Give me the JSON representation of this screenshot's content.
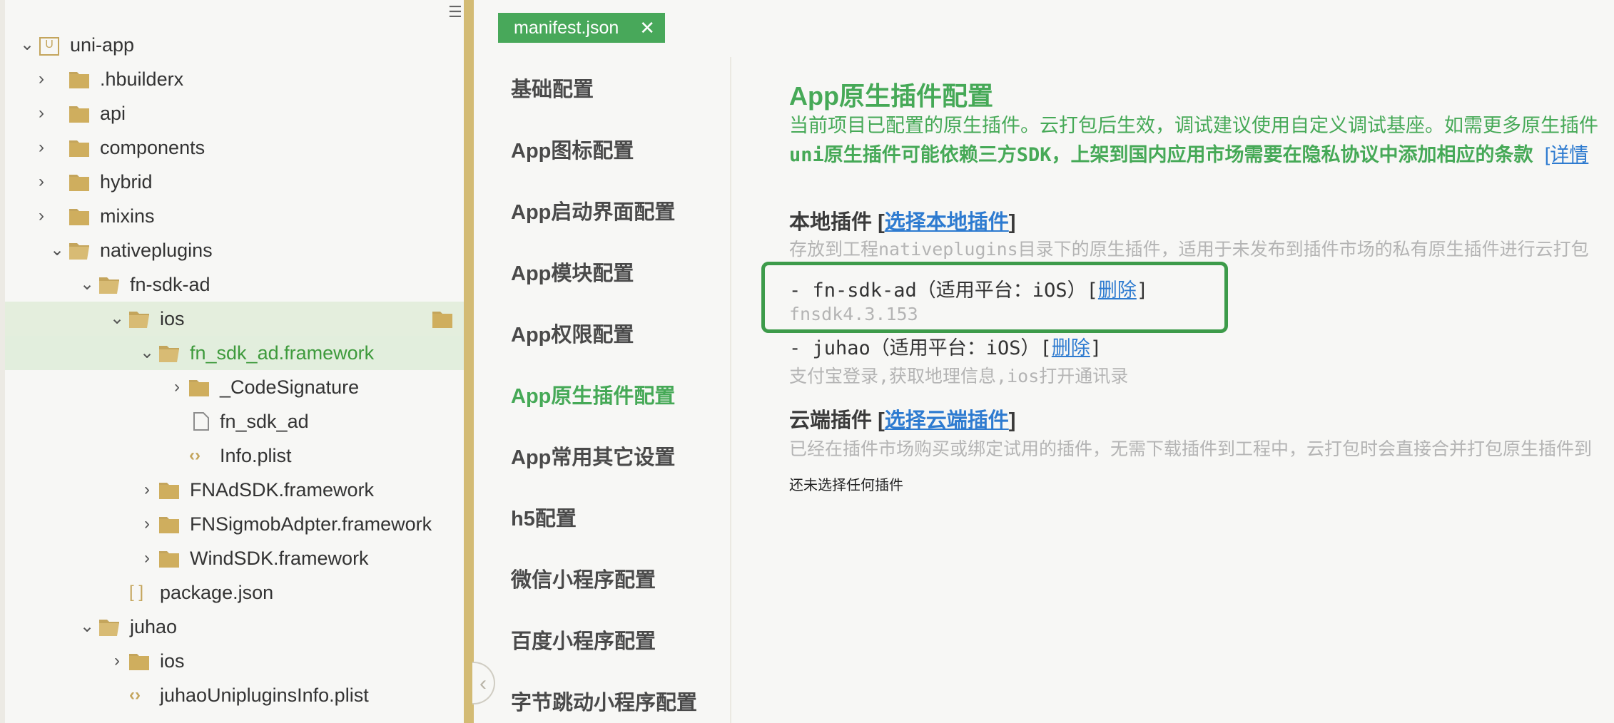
{
  "tree": {
    "rows": [
      {
        "label": "uni-app",
        "type": "app",
        "expanded": true
      },
      {
        "label": ".hbuilderx",
        "type": "folder",
        "expanded": false
      },
      {
        "label": "api",
        "type": "folder",
        "expanded": false
      },
      {
        "label": "components",
        "type": "folder",
        "expanded": false
      },
      {
        "label": "hybrid",
        "type": "folder",
        "expanded": false
      },
      {
        "label": "mixins",
        "type": "folder",
        "expanded": false
      },
      {
        "label": "nativeplugins",
        "type": "folder-open",
        "expanded": true
      },
      {
        "label": "fn-sdk-ad",
        "type": "folder-open",
        "expanded": true
      },
      {
        "label": "ios",
        "type": "folder-open",
        "expanded": true
      },
      {
        "label": "fn_sdk_ad.framework",
        "type": "folder-open",
        "expanded": true
      },
      {
        "label": "_CodeSignature",
        "type": "folder",
        "expanded": false
      },
      {
        "label": "fn_sdk_ad",
        "type": "file"
      },
      {
        "label": "Info.plist",
        "type": "code"
      },
      {
        "label": "FNAdSDK.framework",
        "type": "folder",
        "expanded": false
      },
      {
        "label": "FNSigmobAdpter.framework",
        "type": "folder",
        "expanded": false
      },
      {
        "label": "WindSDK.framework",
        "type": "folder",
        "expanded": false
      },
      {
        "label": "package.json",
        "type": "json"
      },
      {
        "label": "juhao",
        "type": "folder-open",
        "expanded": true
      },
      {
        "label": "ios",
        "type": "folder",
        "expanded": false
      },
      {
        "label": "juhaoUnipluginsInfo.plist",
        "type": "code"
      }
    ]
  },
  "tab": {
    "label": "manifest.json",
    "close": "✕"
  },
  "nav": {
    "items": [
      "基础配置",
      "App图标配置",
      "App启动界面配置",
      "App模块配置",
      "App权限配置",
      "App原生插件配置",
      "App常用其它设置",
      "h5配置",
      "微信小程序配置",
      "百度小程序配置",
      "字节跳动小程序配置"
    ],
    "active_index": 5
  },
  "content": {
    "title": "App原生插件配置",
    "desc1": "当前项目已配置的原生插件。云打包后生效，调试建议使用自定义调试基座。如需更多原生插件",
    "desc2": "uni原生插件可能依赖三方SDK，上架到国内应用市场需要在隐私协议中添加相应的条款",
    "desc2_link": "[详情",
    "local": {
      "head": "本地插件",
      "bracket_open": "[",
      "link": "选择本地插件",
      "bracket_close": "]",
      "hint": "存放到工程nativeplugins目录下的原生插件，适用于未发布到插件市场的私有原生插件进行云打包"
    },
    "plugins": [
      {
        "text": "- fn-sdk-ad（适用平台：iOS）[",
        "link": "删除",
        "close": "]",
        "sub": "fnsdk4.3.153"
      },
      {
        "text": "- juhao（适用平台：iOS）[",
        "link": "删除",
        "close": "]",
        "sub": "支付宝登录,获取地理信息,ios打开通讯录"
      }
    ],
    "cloud": {
      "head": "云端插件",
      "bracket_open": "[",
      "link": "选择云端插件",
      "bracket_close": "]",
      "hint": "已经在插件市场购买或绑定试用的插件，无需下载插件到工程中，云打包时会直接合并打包原生插件到"
    },
    "empty_note": "还未选择任何插件"
  },
  "colors": {
    "accent": "#46a957",
    "link": "#2e7bd0",
    "folder": "#cfae5e"
  }
}
